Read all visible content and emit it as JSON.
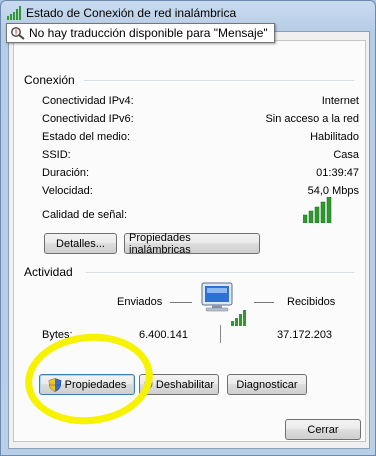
{
  "window": {
    "title": "Estado de Conexión de red inalámbrica"
  },
  "tooltip": {
    "text": "No hay traducción disponible para \"Mensaje\""
  },
  "connection": {
    "title": "Conexión",
    "rows": [
      {
        "label": "Conectividad IPv4:",
        "value": "Internet"
      },
      {
        "label": "Conectividad IPv6:",
        "value": "Sin acceso a la red"
      },
      {
        "label": "Estado del medio:",
        "value": "Habilitado"
      },
      {
        "label": "SSID:",
        "value": "Casa"
      },
      {
        "label": "Duración:",
        "value": "01:39:47"
      },
      {
        "label": "Velocidad:",
        "value": "54,0 Mbps"
      }
    ],
    "signal_label": "Calidad de señal:",
    "signal_bars": 5,
    "details_button": "Detalles...",
    "wireless_props_button": "Propiedades inalámbricas"
  },
  "activity": {
    "title": "Actividad",
    "sent_label": "Enviados",
    "received_label": "Recibidos",
    "bytes_label": "Bytes:",
    "bytes_sent": "6.400.141",
    "bytes_received": "37.172.203"
  },
  "buttons": {
    "properties": "Propiedades",
    "disable": "Deshabilitar",
    "diagnose": "Diagnosticar",
    "close": "Cerrar"
  },
  "colors": {
    "highlight": "#f7f200",
    "signal": "#2e9a2e"
  }
}
